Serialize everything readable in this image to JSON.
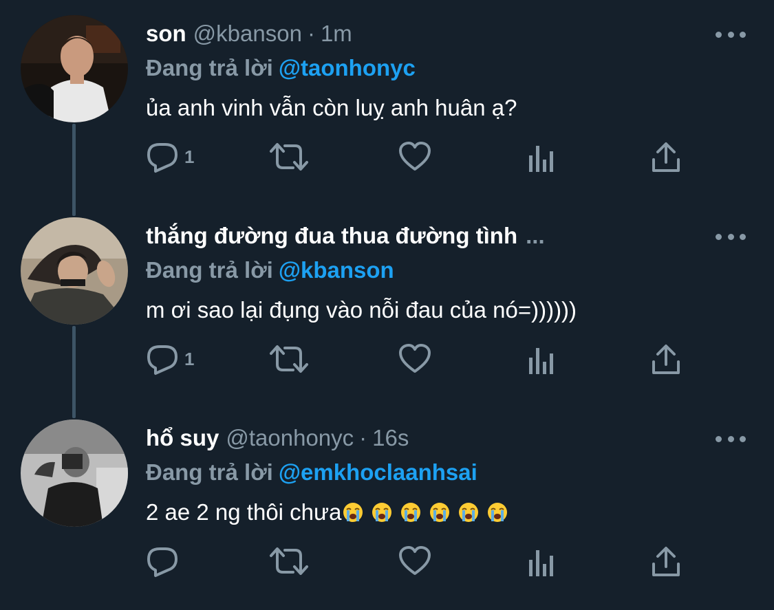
{
  "tweets": [
    {
      "name": "son",
      "handle": "@kbanson",
      "separator": "·",
      "time": "1m",
      "reply_prefix": "Đang trả lời",
      "reply_to": "@taonhonyc",
      "text": "ủa anh vinh vẫn còn luỵ anh huân ạ?",
      "reply_count": "1",
      "emoji_count": 0
    },
    {
      "name": "thắng đường đua thua đường tình",
      "name_overflow": "...",
      "reply_prefix": "Đang trả lời",
      "reply_to": "@kbanson",
      "text": "m ơi sao lại đụng vào nỗi đau của nó=))))))",
      "reply_count": "1",
      "emoji_count": 0
    },
    {
      "name": "hổ suy",
      "handle": "@taonhonyc",
      "separator": "·",
      "time": "16s",
      "reply_prefix": "Đang trả lời",
      "reply_to": "@emkhoclaanhsai",
      "text": "2 ae 2 ng thôi chưa",
      "reply_count": "",
      "emoji": "loudly-crying-face",
      "emoji_count": 6
    }
  ],
  "icons": {
    "reply": "reply-icon",
    "retweet": "retweet-icon",
    "like": "heart-icon",
    "stats": "analytics-icon",
    "share": "share-icon",
    "more": "more-horizontal-icon"
  },
  "colors": {
    "background": "#15202b",
    "secondary_text": "#8899a6",
    "link": "#1da1f2",
    "thread_line": "#3d5466"
  }
}
